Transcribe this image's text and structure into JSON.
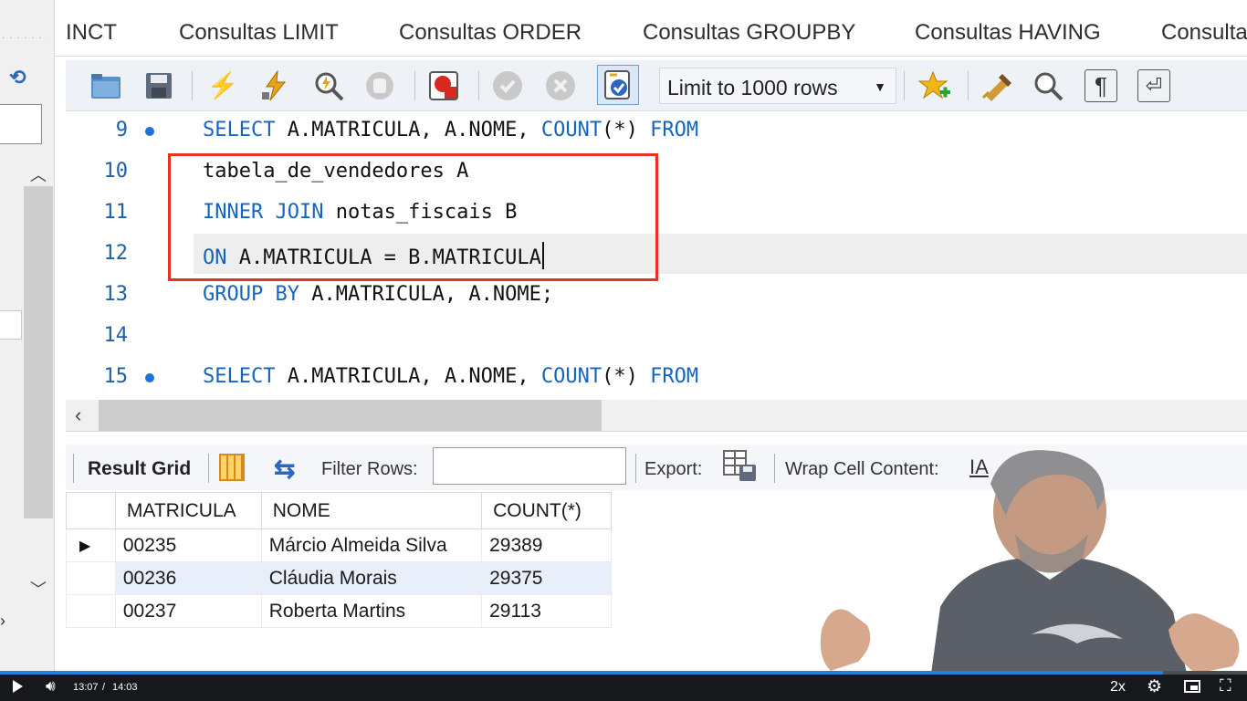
{
  "tabs": [
    {
      "label": "INCT"
    },
    {
      "label": "Consultas LIMIT"
    },
    {
      "label": "Consultas ORDER"
    },
    {
      "label": "Consultas GROUPBY"
    },
    {
      "label": "Consultas HAVING"
    },
    {
      "label": "Consulta"
    }
  ],
  "toolbar": {
    "icons": [
      "open-folder-icon",
      "save-icon",
      "execute-icon",
      "execute-current-icon",
      "explain-icon",
      "stop-icon",
      "toggle-error-icon",
      "commit-icon",
      "rollback-icon",
      "autocommit-icon",
      "limit-select",
      "add-snippet-icon",
      "beautify-icon",
      "find-icon",
      "invisible-chars-icon",
      "word-wrap-icon"
    ],
    "limit_value": "Limit to 1000 rows"
  },
  "editor": {
    "lines": [
      {
        "num": "9",
        "dot": true,
        "parts": [
          {
            "t": "SELECT",
            "k": 1
          },
          {
            "t": " A.MATRICULA, A.NOME, ",
            "k": 0
          },
          {
            "t": "COUNT",
            "k": 1
          },
          {
            "t": "(*) ",
            "k": 0
          },
          {
            "t": "FROM",
            "k": 1
          }
        ]
      },
      {
        "num": "10",
        "dot": false,
        "parts": [
          {
            "t": "tabela_de_vendedores A",
            "k": 0
          }
        ]
      },
      {
        "num": "11",
        "dot": false,
        "parts": [
          {
            "t": "INNER JOIN",
            "k": 1
          },
          {
            "t": " notas_fiscais B",
            "k": 0
          }
        ]
      },
      {
        "num": "12",
        "dot": false,
        "parts": [
          {
            "t": "ON",
            "k": 1
          },
          {
            "t": " A.MATRICULA = B.MATRICULA",
            "k": 0
          }
        ]
      },
      {
        "num": "13",
        "dot": false,
        "parts": [
          {
            "t": "GROUP BY",
            "k": 1
          },
          {
            "t": " A.MATRICULA, A.NOME;",
            "k": 0
          }
        ]
      },
      {
        "num": "14",
        "dot": false,
        "parts": []
      },
      {
        "num": "15",
        "dot": true,
        "parts": [
          {
            "t": "SELECT",
            "k": 1
          },
          {
            "t": " A.MATRICULA, A.NOME, ",
            "k": 0
          },
          {
            "t": "COUNT",
            "k": 1
          },
          {
            "t": "(*) ",
            "k": 0
          },
          {
            "t": "FROM",
            "k": 1
          }
        ]
      }
    ],
    "colors": {
      "keyword": "#1565c0",
      "highlight_box": "#e53222"
    }
  },
  "results": {
    "grid_label": "Result Grid",
    "filter_label": "Filter Rows:",
    "filter_value": "",
    "export_label": "Export:",
    "wrap_label": "Wrap Cell Content:",
    "wrap_icon_text": "IA",
    "columns": [
      "MATRICULA",
      "NOME",
      "COUNT(*)"
    ],
    "rows": [
      {
        "marker": "▶",
        "cells": [
          "00235",
          "Márcio Almeida Silva",
          "29389"
        ]
      },
      {
        "marker": "",
        "cells": [
          "00236",
          "Cláudia Morais",
          "29375"
        ]
      },
      {
        "marker": "",
        "cells": [
          "00237",
          "Roberta Martins",
          "29113"
        ]
      }
    ]
  },
  "player": {
    "current_time": "13:07",
    "separator": "/",
    "total_time": "14:03",
    "progress": 0.933,
    "speed": "2x",
    "progress_color": "#1e7fdc"
  }
}
